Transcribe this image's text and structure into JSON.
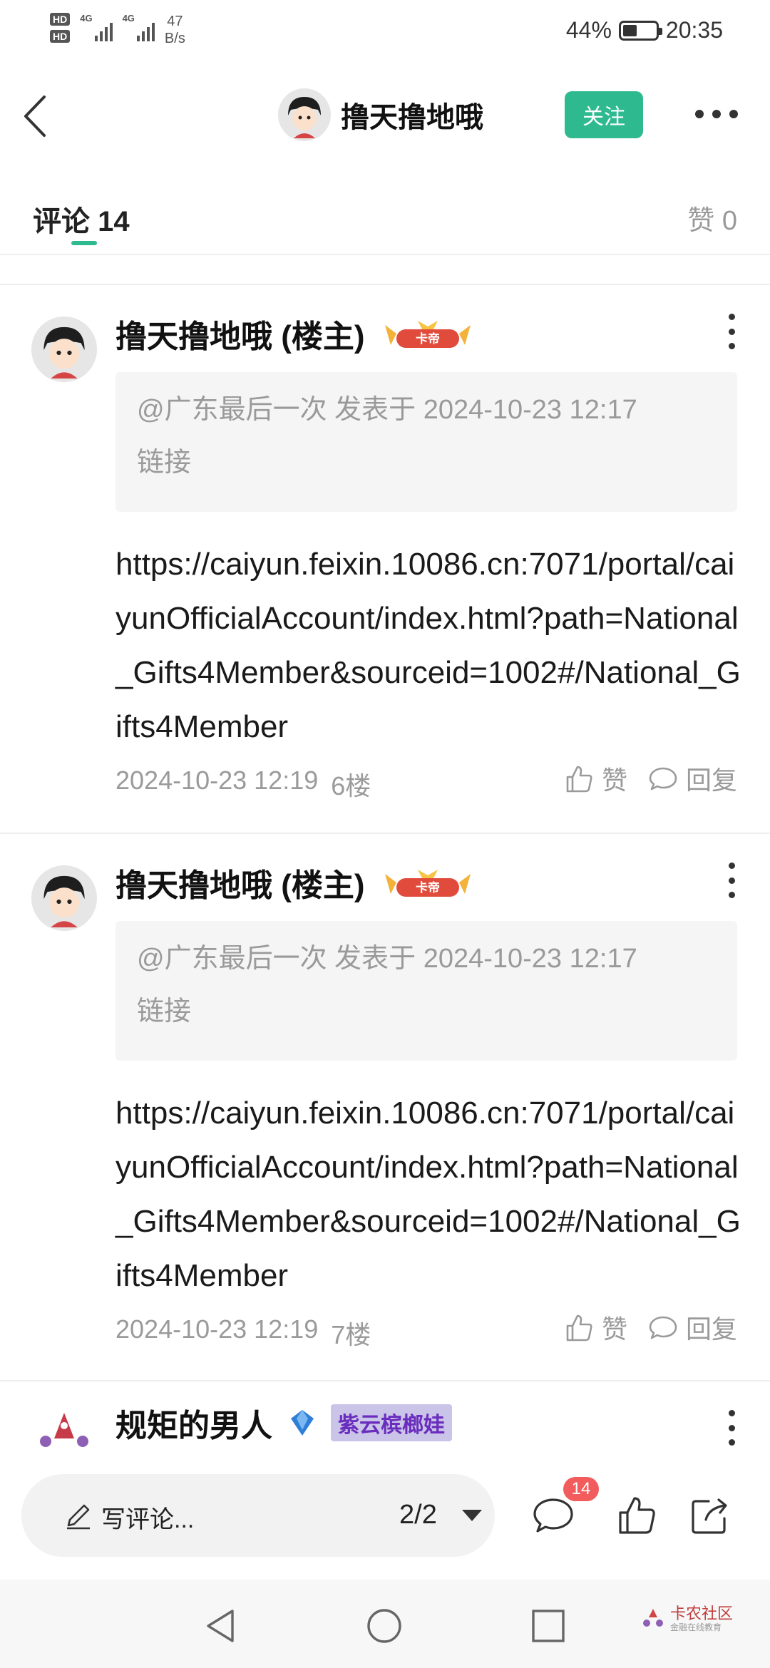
{
  "status_bar": {
    "hd1": "HD",
    "hd2": "HD",
    "net1": "4G",
    "net2": "4G",
    "speed_value": "47",
    "speed_unit": "B/s",
    "battery_percent": "44%",
    "battery_level": 0.44,
    "time": "20:35"
  },
  "header": {
    "username": "撸天撸地哦",
    "follow_label": "关注"
  },
  "tabs": {
    "comments_label": "评论",
    "comments_count": "14",
    "likes_label": "赞",
    "likes_count": "0"
  },
  "comments": [
    {
      "name": "撸天撸地哦",
      "role": "(楼主)",
      "badge_text": "卡帝",
      "quote_meta": "@广东最后一次 发表于 2024-10-23 12:17",
      "quote_text": "链接",
      "text": "https://caiyun.feixin.10086.cn:7071/portal/caiyunOfficialAccount/index.html?path=National_Gifts4Member&sourceid=1002#/National_Gifts4Member",
      "time": "2024-10-23 12:19",
      "floor": "6楼",
      "like_label": "赞",
      "reply_label": "回复"
    },
    {
      "name": "撸天撸地哦",
      "role": "(楼主)",
      "badge_text": "卡帝",
      "quote_meta": "@广东最后一次 发表于 2024-10-23 12:17",
      "quote_text": "链接",
      "text": "https://caiyun.feixin.10086.cn:7071/portal/caiyunOfficialAccount/index.html?path=National_Gifts4Member&sourceid=1002#/National_Gifts4Member",
      "time": "2024-10-23 12:19",
      "floor": "7楼",
      "like_label": "赞",
      "reply_label": "回复"
    },
    {
      "name": "规矩的男人",
      "title_tag": "紫云槟榔娃"
    }
  ],
  "bottom_bar": {
    "write_placeholder": "写评论...",
    "page_indicator": "2/2",
    "comment_badge": "14"
  },
  "watermark": {
    "name": "卡农社区",
    "sub": "金融在线教育"
  }
}
